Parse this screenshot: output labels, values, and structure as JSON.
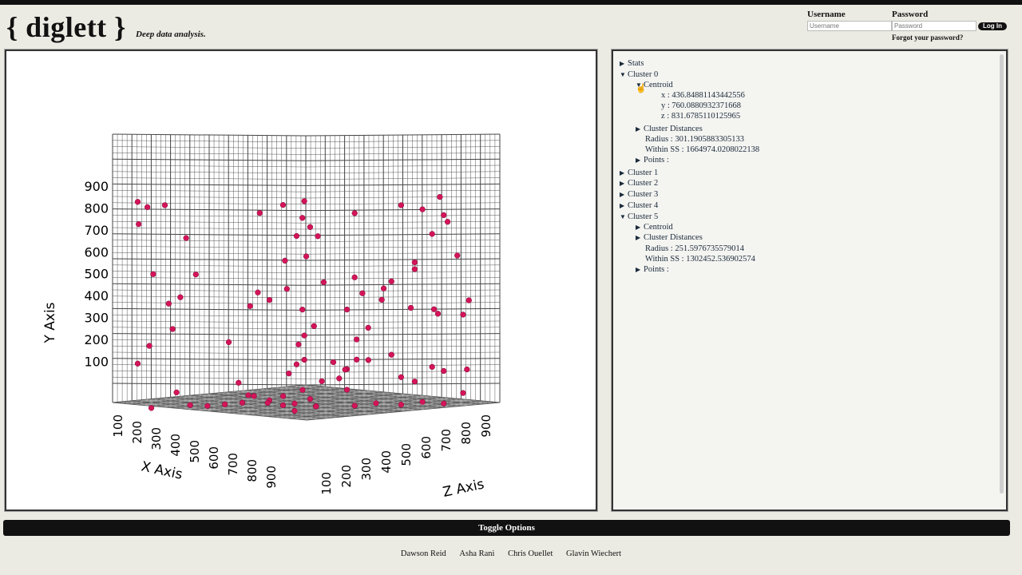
{
  "app": {
    "logo": "{ diglett }",
    "tagline": "Deep data analysis."
  },
  "login": {
    "username_label": "Username",
    "username_placeholder": "Username",
    "password_label": "Password",
    "password_placeholder": "Password",
    "login_button": "Log In",
    "forgot": "Forgot your password?"
  },
  "tree": {
    "stats": "Stats",
    "cluster0": "Cluster 0",
    "centroid": "Centroid",
    "c0_x": "x : 436.84881143442556",
    "c0_y": "y : 760.0880932371668",
    "c0_z": "z : 831.6785110125965",
    "cluster_distances": "Cluster Distances",
    "c0_radius": "Radius : 301.1905883305133",
    "c0_within": "Within SS : 1664974.0208022138",
    "points": "Points :",
    "cluster1": "Cluster 1",
    "cluster2": "Cluster 2",
    "cluster3": "Cluster 3",
    "cluster4": "Cluster 4",
    "cluster5": "Cluster 5",
    "c5_centroid": "Centroid",
    "c5_distances": "Cluster Distances",
    "c5_radius": "Radius : 251.5976735579014",
    "c5_within": "Within SS : 1302452.536902574",
    "c5_points": "Points :"
  },
  "toggle_label": "Toggle Options",
  "credits": [
    "Dawson Reid",
    "Asha Rani",
    "Chris Ouellet",
    "Glavin Wiechert"
  ],
  "colors": {
    "point": "#d4145a",
    "grid": "#333333",
    "accent": "#111111"
  },
  "chart_data": {
    "type": "scatter",
    "title": "",
    "xlabel": "X Axis",
    "ylabel": "Y Axis",
    "zlabel": "Z Axis",
    "x_ticks": [
      "100",
      "200",
      "300",
      "400",
      "500",
      "600",
      "700",
      "800",
      "900"
    ],
    "y_ticks": [
      "100",
      "200",
      "300",
      "400",
      "500",
      "600",
      "700",
      "800",
      "900"
    ],
    "z_ticks": [
      "100",
      "200",
      "300",
      "400",
      "500",
      "600",
      "700",
      "800",
      "900"
    ],
    "xlim": [
      0,
      1000
    ],
    "ylim": [
      0,
      1000
    ],
    "zlim": [
      0,
      1000
    ],
    "grid": true,
    "points": [
      [
        30,
        910,
        900
      ],
      [
        60,
        890,
        880
      ],
      [
        120,
        905,
        850
      ],
      [
        15,
        810,
        880
      ],
      [
        80,
        600,
        870
      ],
      [
        200,
        770,
        820
      ],
      [
        210,
        610,
        780
      ],
      [
        150,
        480,
        860
      ],
      [
        180,
        510,
        830
      ],
      [
        160,
        370,
        850
      ],
      [
        90,
        290,
        900
      ],
      [
        60,
        210,
        930
      ],
      [
        300,
        320,
        700
      ],
      [
        400,
        890,
        640
      ],
      [
        480,
        930,
        600
      ],
      [
        550,
        950,
        560
      ],
      [
        560,
        880,
        580
      ],
      [
        580,
        840,
        560
      ],
      [
        600,
        800,
        540
      ],
      [
        540,
        800,
        590
      ],
      [
        500,
        690,
        610
      ],
      [
        560,
        710,
        560
      ],
      [
        520,
        570,
        620
      ],
      [
        430,
        550,
        680
      ],
      [
        470,
        520,
        660
      ],
      [
        410,
        490,
        700
      ],
      [
        560,
        480,
        580
      ],
      [
        600,
        410,
        560
      ],
      [
        580,
        370,
        590
      ],
      [
        560,
        330,
        600
      ],
      [
        620,
        600,
        530
      ],
      [
        700,
        900,
        450
      ],
      [
        820,
        930,
        330
      ],
      [
        880,
        910,
        280
      ],
      [
        920,
        960,
        230
      ],
      [
        930,
        880,
        220
      ],
      [
        940,
        850,
        210
      ],
      [
        900,
        800,
        250
      ],
      [
        960,
        700,
        180
      ],
      [
        980,
        500,
        140
      ],
      [
        860,
        680,
        300
      ],
      [
        860,
        650,
        300
      ],
      [
        800,
        600,
        360
      ],
      [
        780,
        570,
        380
      ],
      [
        720,
        550,
        430
      ],
      [
        700,
        620,
        450
      ],
      [
        680,
        480,
        470
      ],
      [
        770,
        520,
        380
      ],
      [
        840,
        480,
        300
      ],
      [
        740,
        400,
        420
      ],
      [
        710,
        350,
        450
      ],
      [
        800,
        280,
        360
      ],
      [
        900,
        220,
        250
      ],
      [
        700,
        260,
        440
      ],
      [
        680,
        220,
        470
      ],
      [
        660,
        180,
        490
      ],
      [
        680,
        130,
        470
      ],
      [
        820,
        180,
        330
      ],
      [
        860,
        160,
        300
      ],
      [
        930,
        200,
        220
      ],
      [
        980,
        200,
        150
      ],
      [
        900,
        470,
        240
      ],
      [
        910,
        450,
        230
      ],
      [
        970,
        440,
        160
      ],
      [
        640,
        250,
        500
      ],
      [
        560,
        260,
        570
      ],
      [
        540,
        240,
        590
      ],
      [
        520,
        200,
        610
      ],
      [
        580,
        90,
        560
      ],
      [
        540,
        70,
        600
      ],
      [
        500,
        60,
        620
      ],
      [
        460,
        80,
        650
      ],
      [
        300,
        50,
        720
      ],
      [
        250,
        40,
        760
      ],
      [
        350,
        60,
        680
      ],
      [
        380,
        90,
        650
      ],
      [
        600,
        60,
        550
      ],
      [
        700,
        60,
        450
      ],
      [
        760,
        70,
        400
      ],
      [
        820,
        60,
        330
      ],
      [
        880,
        70,
        280
      ],
      [
        940,
        60,
        230
      ],
      [
        980,
        100,
        170
      ],
      [
        300,
        60,
        900
      ],
      [
        250,
        110,
        920
      ],
      [
        150,
        30,
        950
      ],
      [
        500,
        180,
        850
      ],
      [
        540,
        130,
        840
      ],
      [
        600,
        100,
        800
      ],
      [
        640,
        130,
        760
      ],
      [
        700,
        160,
        720
      ],
      [
        760,
        200,
        680
      ],
      [
        820,
        250,
        620
      ],
      [
        880,
        290,
        560
      ],
      [
        700,
        80,
        650
      ],
      [
        500,
        30,
        560
      ]
    ]
  }
}
